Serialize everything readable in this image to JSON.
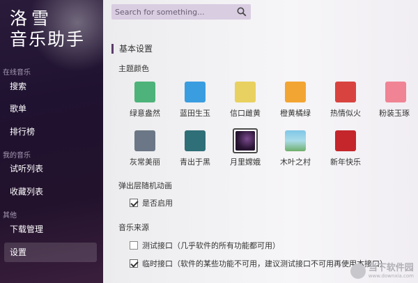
{
  "app": {
    "logo_line1": "洛雪",
    "logo_line2": "音乐助手"
  },
  "sidebar": {
    "sections": [
      "在线音乐",
      "我的音乐",
      "其他"
    ],
    "items": [
      {
        "label": "搜索"
      },
      {
        "label": "歌单"
      },
      {
        "label": "排行榜"
      },
      {
        "label": "试听列表"
      },
      {
        "label": "收藏列表"
      },
      {
        "label": "下载管理"
      },
      {
        "label": "设置"
      }
    ],
    "active": "设置"
  },
  "search": {
    "placeholder": "Search for something...",
    "icon": "search-icon"
  },
  "settings": {
    "section_title": "基本设置",
    "theme": {
      "label": "主题颜色",
      "swatches": [
        {
          "name": "绿意盎然",
          "color": "#4db37a"
        },
        {
          "name": "蓝田生玉",
          "color": "#3a9de0"
        },
        {
          "name": "信口雌黄",
          "color": "#e8d160"
        },
        {
          "name": "橙黄橘绿",
          "color": "#f3a533"
        },
        {
          "name": "热情似火",
          "color": "#d9433f"
        },
        {
          "name": "粉装玉琢",
          "color": "#f08494"
        },
        {
          "name": "灰常美丽",
          "color": "#6b7786"
        },
        {
          "name": "青出于黑",
          "color": "#2f6f78"
        },
        {
          "name": "月里嫦娥",
          "color": "#2a1535"
        },
        {
          "name": "木叶之村",
          "color": "#7fc7e8"
        },
        {
          "name": "新年快乐",
          "color": "#c4262b"
        }
      ],
      "selected": "月里嫦娥"
    },
    "popup_anim": {
      "label": "弹出层随机动画",
      "option": "是否启用",
      "checked": true
    },
    "music_source": {
      "label": "音乐来源",
      "options": [
        {
          "text": "测试接口（几乎软件的所有功能都可用）",
          "checked": false
        },
        {
          "text": "临时接口（软件的某些功能不可用，建议测试接口不可用再使用本接口）",
          "checked": true
        }
      ]
    }
  },
  "watermark": {
    "title": "当下软件园",
    "subtitle": "www.downxia.com"
  }
}
